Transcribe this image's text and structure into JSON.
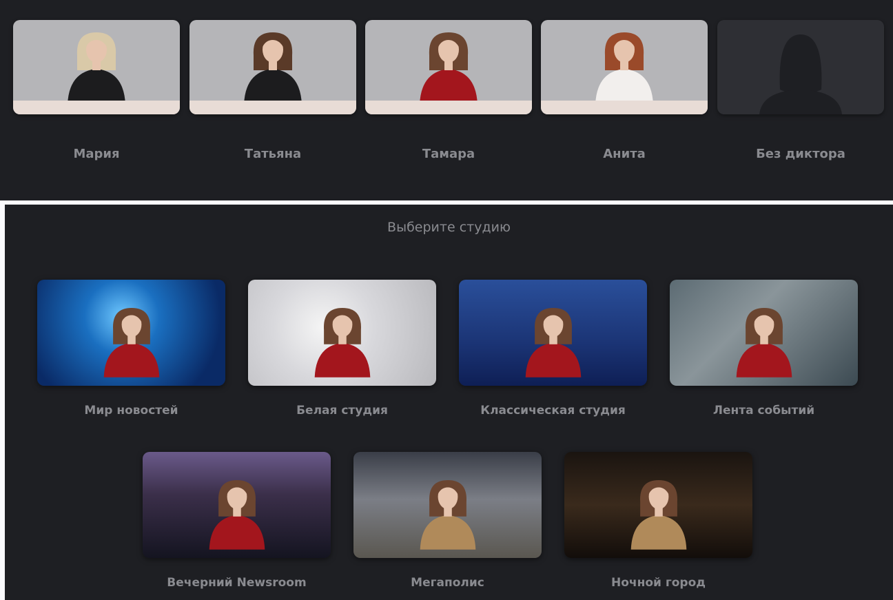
{
  "presenters": [
    {
      "name": "Мария",
      "outfit": "#1c1c1e",
      "hair": "#d9c9a8"
    },
    {
      "name": "Татьяна",
      "outfit": "#1c1c1e",
      "hair": "#5a3a28"
    },
    {
      "name": "Тамара",
      "outfit": "#a3161d",
      "hair": "#6b4530"
    },
    {
      "name": "Анита",
      "outfit": "#f2efed",
      "hair": "#9a4a2a"
    },
    {
      "name": "Без диктора"
    }
  ],
  "studio_title": "Выберите студию",
  "studios": [
    {
      "name": "Мир новостей",
      "bg": "radial-gradient(circle at 45% 35%,#6fc8ff 0,#1a6fc0 30%,#0a2a66 80%)",
      "outfit": "#a3161d"
    },
    {
      "name": "Белая студия",
      "bg": "radial-gradient(circle at 40% 45%,#f5f5f5 0,#d8d8dc 40%,#b8b8bc 100%)",
      "outfit": "#a3161d"
    },
    {
      "name": "Классическая студия",
      "bg": "linear-gradient(180deg,#2a4f9a 0,#1b3475 60%,#0e1f55 100%)",
      "outfit": "#a3161d"
    },
    {
      "name": "Лента событий",
      "bg": "linear-gradient(135deg,#5c6b73 0,#8a959a 40%,#3c4a52 100%)",
      "outfit": "#a3161d"
    },
    {
      "name": "Вечерний Newsroom",
      "bg": "linear-gradient(180deg,#6a5a8a 0,#3b2f4a 40%,#141420 100%)",
      "outfit": "#a3161d"
    },
    {
      "name": "Мегаполис",
      "bg": "linear-gradient(180deg,#3a3e48 0,#7b7e86 45%,#5a5750 100%)",
      "outfit": "#b08a5a"
    },
    {
      "name": "Ночной город",
      "bg": "linear-gradient(180deg,#1a1410 0,#3a2a1c 50%,#120d0a 100%)",
      "outfit": "#b08a5a"
    }
  ]
}
